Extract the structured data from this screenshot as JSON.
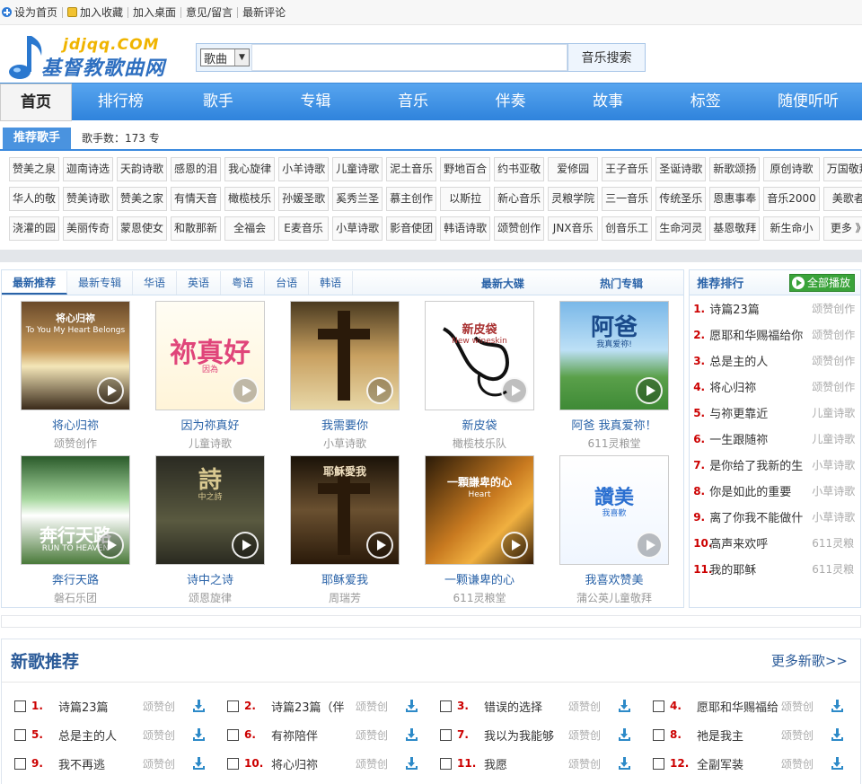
{
  "topbar": {
    "items": [
      "设为首页",
      "加入收藏",
      "加入桌面",
      "意见/留言",
      "最新评论"
    ]
  },
  "logo": {
    "en": "jdjqq.COM",
    "cn": "基督教歌曲网"
  },
  "search": {
    "select_value": "歌曲",
    "input_value": "",
    "button_label": "音乐搜索"
  },
  "nav": {
    "items": [
      "首页",
      "排行榜",
      "歌手",
      "专辑",
      "音乐",
      "伴奏",
      "故事",
      "标签",
      "随便听听"
    ]
  },
  "singers": {
    "title": "推荐歌手",
    "count_label": "歌手数：173 专",
    "items": [
      "赞美之泉",
      "迦南诗选",
      "天韵诗歌",
      "感恩的泪",
      "我心旋律",
      "小羊诗歌",
      "儿童诗歌",
      "泥土音乐",
      "野地百合",
      "约书亚敬",
      "爱修园",
      "王子音乐",
      "圣诞诗歌",
      "新歌颂扬",
      "原创诗歌",
      "万国敬拜",
      "华人的敬",
      "赞美诗歌",
      "赞美之家",
      "有情天音",
      "橄榄枝乐",
      "孙媛圣歌",
      "奚秀兰圣",
      "慕主创作",
      "以斯拉",
      "新心音乐",
      "灵粮学院",
      "三一音乐",
      "传统圣乐",
      "恩惠事奉",
      "音乐2000",
      "美歌者",
      "浇灌的园",
      "美丽传奇",
      "蒙恩使女",
      "和散那新",
      "全福会",
      "E麦音乐",
      "小草诗歌",
      "影音使团",
      "韩语诗歌",
      "颂赞创作",
      "JNX音乐",
      "创音乐工",
      "生命河灵",
      "基恩敬拜",
      "新生命小",
      "更多 》"
    ]
  },
  "albums": {
    "tabs": [
      "最新推荐",
      "最新专辑",
      "华语",
      "英语",
      "粤语",
      "台语",
      "韩语"
    ],
    "right_tabs": [
      "最新大碟",
      "热门专辑"
    ],
    "items": [
      {
        "name": "将心归祢",
        "artist": "颂赞创作",
        "cover_text": "将心归祢",
        "cover_sub": "To You My Heart Belongs"
      },
      {
        "name": "因为祢真好",
        "artist": "儿童诗歌",
        "cover_text": "祢真好",
        "cover_sub": "因為"
      },
      {
        "name": "我需要你",
        "artist": "小草诗歌",
        "cover_text": "",
        "cover_sub": ""
      },
      {
        "name": "新皮袋",
        "artist": "橄榄枝乐队",
        "cover_text": "新皮袋",
        "cover_sub": "New wineskin"
      },
      {
        "name": "阿爸 我真爱祢！",
        "artist": "611灵粮堂",
        "cover_text": "阿爸",
        "cover_sub": "我真爱祢!"
      },
      {
        "name": "奔行天路",
        "artist": "磐石乐团",
        "cover_text": "奔行天路",
        "cover_sub": "RUN TO HEAVEN"
      },
      {
        "name": "诗中之诗",
        "artist": "颂恩旋律",
        "cover_text": "詩",
        "cover_sub": "中之詩"
      },
      {
        "name": "耶稣爱我",
        "artist": "周瑞芳",
        "cover_text": "耶穌愛我",
        "cover_sub": ""
      },
      {
        "name": "一颗谦卑的心",
        "artist": "611灵粮堂",
        "cover_text": "一顆謙卑的心",
        "cover_sub": "Heart"
      },
      {
        "name": "我喜欢赞美",
        "artist": "蒲公英儿童敬拜",
        "cover_text": "讚美",
        "cover_sub": "我喜歡"
      }
    ]
  },
  "rank": {
    "title": "推荐排行",
    "play_all": "全部播放",
    "items": [
      {
        "n": "1.",
        "title": "诗篇23篇",
        "artist": "颂赞创作"
      },
      {
        "n": "2.",
        "title": "愿耶和华赐福给你",
        "artist": "颂赞创作"
      },
      {
        "n": "3.",
        "title": "总是主的人",
        "artist": "颂赞创作"
      },
      {
        "n": "4.",
        "title": "将心归祢",
        "artist": "颂赞创作"
      },
      {
        "n": "5.",
        "title": "与祢更靠近",
        "artist": "儿童诗歌"
      },
      {
        "n": "6.",
        "title": "一生跟随祢",
        "artist": "儿童诗歌"
      },
      {
        "n": "7.",
        "title": "是你给了我新的生",
        "artist": "小草诗歌"
      },
      {
        "n": "8.",
        "title": "你是如此的重要",
        "artist": "小草诗歌"
      },
      {
        "n": "9.",
        "title": "离了你我不能做什",
        "artist": "小草诗歌"
      },
      {
        "n": "10.",
        "title": "高声来欢呼",
        "artist": "611灵粮"
      },
      {
        "n": "11.",
        "title": "我的耶稣",
        "artist": "611灵粮"
      }
    ]
  },
  "newsongs": {
    "title": "新歌推荐",
    "more": "更多新歌>>",
    "items": [
      {
        "n": "1.",
        "title": "诗篇23篇",
        "artist": "颂赞创"
      },
      {
        "n": "2.",
        "title": "诗篇23篇（伴",
        "artist": "颂赞创"
      },
      {
        "n": "3.",
        "title": "错误的选择",
        "artist": "颂赞创"
      },
      {
        "n": "4.",
        "title": "愿耶和华赐福给",
        "artist": "颂赞创"
      },
      {
        "n": "5.",
        "title": "总是主的人",
        "artist": "颂赞创"
      },
      {
        "n": "6.",
        "title": "有祢陪伴",
        "artist": "颂赞创"
      },
      {
        "n": "7.",
        "title": "我以为我能够",
        "artist": "颂赞创"
      },
      {
        "n": "8.",
        "title": "祂是我主",
        "artist": "颂赞创"
      },
      {
        "n": "9.",
        "title": "我不再逃",
        "artist": "颂赞创"
      },
      {
        "n": "10.",
        "title": "将心归祢",
        "artist": "颂赞创"
      },
      {
        "n": "11.",
        "title": "我愿",
        "artist": "颂赞创"
      },
      {
        "n": "12.",
        "title": "全副军装",
        "artist": "颂赞创"
      }
    ]
  }
}
